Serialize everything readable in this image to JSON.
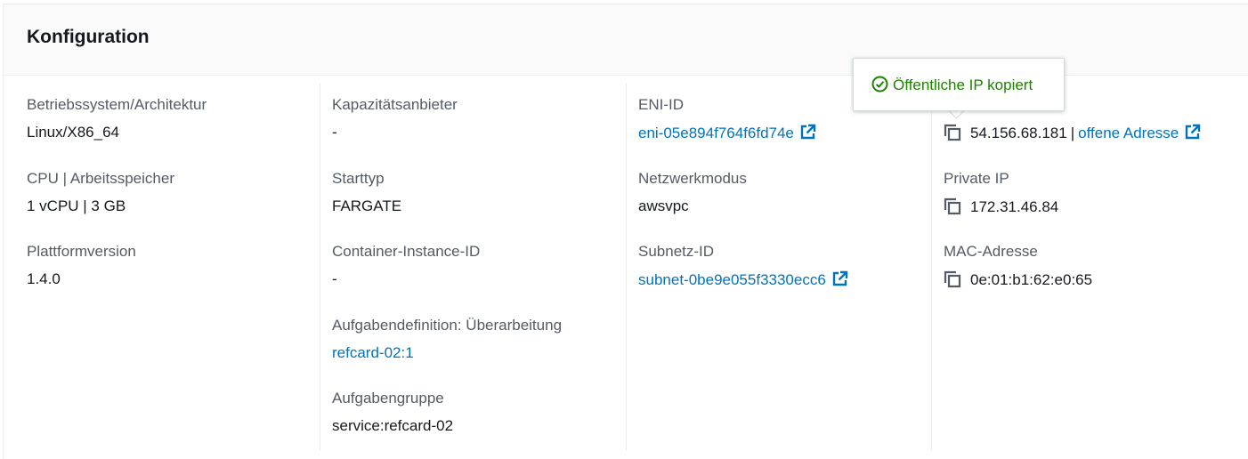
{
  "section": {
    "title": "Konfiguration"
  },
  "columns": [
    {
      "fields": [
        {
          "label": "Betriebssystem/Architektur",
          "value": "Linux/X86_64"
        },
        {
          "label": "CPU | Arbeitsspeicher",
          "value": "1 vCPU | 3 GB"
        },
        {
          "label": "Plattformversion",
          "value": "1.4.0"
        }
      ]
    },
    {
      "fields": [
        {
          "label": "Kapazitätsanbieter",
          "value": "-"
        },
        {
          "label": "Starttyp",
          "value": "FARGATE"
        },
        {
          "label": "Container-Instance-ID",
          "value": "-"
        },
        {
          "label": "Aufgabendefinition: Überarbeitung",
          "value": "refcard-02:1"
        },
        {
          "label": "Aufgabengruppe",
          "value": "service:refcard-02"
        }
      ]
    },
    {
      "fields": [
        {
          "label": "ENI-ID",
          "value": "eni-05e894f764f6fd74e"
        },
        {
          "label": "Netzwerkmodus",
          "value": "awsvpc"
        },
        {
          "label": "Subnetz-ID",
          "value": "subnet-0be9e055f3330ecc6"
        }
      ]
    },
    {
      "public_ip": {
        "value": "54.156.68.181",
        "separator": "|",
        "link": "offene Adresse"
      },
      "fields": [
        {
          "label": "Private IP",
          "value": "172.31.46.84"
        },
        {
          "label": "MAC-Adresse",
          "value": "0e:01:b1:62:e0:65"
        }
      ]
    }
  ],
  "popover": {
    "message": "Öffentliche IP kopiert",
    "icon": "check-circle-icon",
    "color": "#1d8102"
  },
  "colors": {
    "link": "#0073bb",
    "label": "#545b64",
    "text": "#16191f",
    "success": "#1d8102"
  }
}
